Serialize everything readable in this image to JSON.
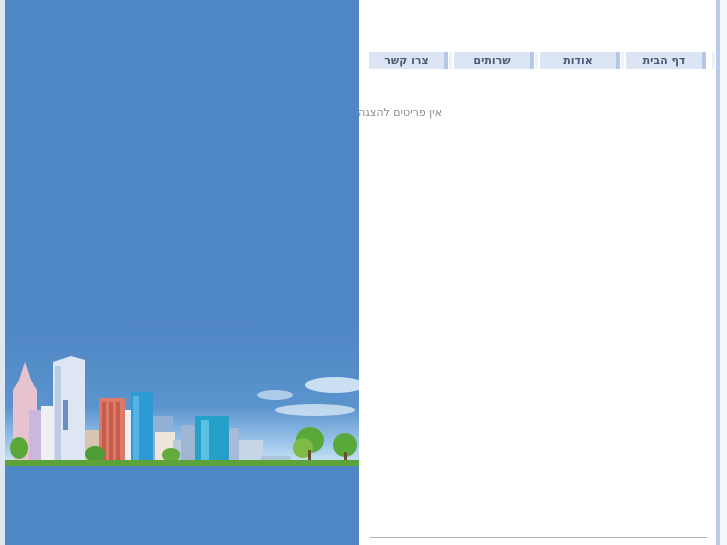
{
  "nav": {
    "items": [
      {
        "label": "דף הבית"
      },
      {
        "label": "אודות"
      },
      {
        "label": "שרותים"
      },
      {
        "label": "צרו קשר"
      }
    ]
  },
  "main": {
    "empty_message": "אין פריטים להצגה"
  },
  "colors": {
    "hero_blue": "#4f86c4",
    "nav_bg": "#dbe5f3",
    "nav_border": "#b3c8e6",
    "nav_text": "#4a5a78"
  }
}
